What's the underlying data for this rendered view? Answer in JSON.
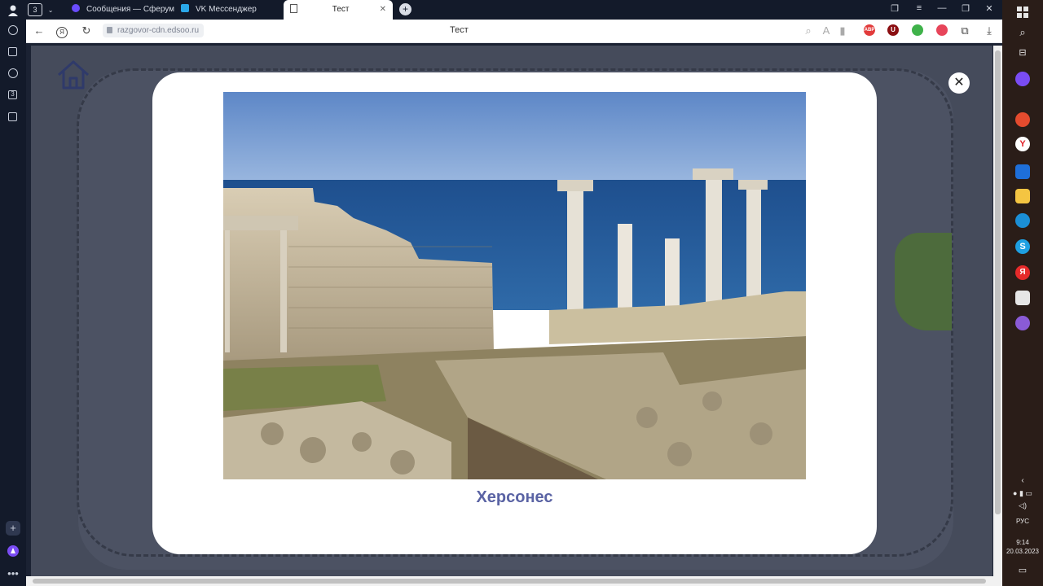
{
  "tabs": [
    {
      "label": "Сообщения — Сферум",
      "color": "#6a4cff"
    },
    {
      "label": "VK Мессенджер",
      "color": "#2aa7e8"
    },
    {
      "label": "Тест",
      "active": true
    }
  ],
  "tab_counter": "3",
  "address": {
    "url": "razgovor-cdn.edsoo.ru",
    "page_title": "Тест"
  },
  "extensions": [
    {
      "name": "abp",
      "label": "ABP",
      "color": "#e23b3b"
    },
    {
      "name": "ublock",
      "label": "U",
      "color": "#8b0f12"
    },
    {
      "name": "shield",
      "label": "",
      "color": "#3fb24a"
    },
    {
      "name": "pocket",
      "label": "",
      "color": "#e7455a"
    }
  ],
  "modal": {
    "caption": "Херсонес",
    "close_symbol": "✕"
  },
  "taskbar": {
    "lang": "РУС",
    "time": "9:14",
    "date": "20.03.2023"
  },
  "colors": {
    "caption": "#5a63a4",
    "modal_bg": "#ffffff",
    "overlay": "#454b5b"
  }
}
